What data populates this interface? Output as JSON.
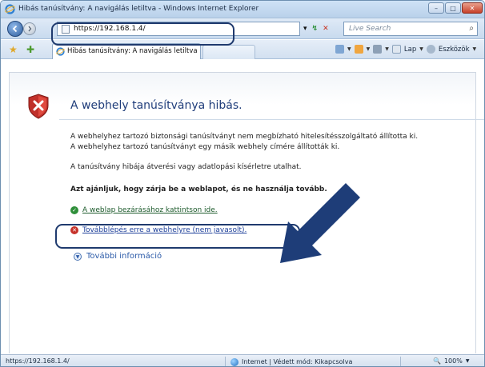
{
  "window": {
    "title": "Hibás tanúsítvány: A navigálás letiltva - Windows Internet Explorer",
    "controls": {
      "minimize": "–",
      "maximize": "□",
      "close": "✕"
    }
  },
  "address_bar": {
    "url": "https://192.168.1.4/",
    "dropdown_glyph": "▾",
    "refresh_glyph": "↯",
    "stop_glyph": "✕",
    "search_placeholder": "Live Search",
    "search_glyph": "⌕"
  },
  "tabs": [
    {
      "label": "Hibás tanúsítvány: A navigálás letiltva"
    }
  ],
  "command_bar": {
    "page_label": "Lap",
    "tools_label": "Eszközök"
  },
  "page": {
    "heading": "A webhely tanúsítványa hibás.",
    "para1_line1": "A webhelyhez tartozó biztonsági tanúsítványt nem megbízható hitelesítésszolgáltató állította ki.",
    "para1_line2": "A webhelyhez tartozó tanúsítványt egy másik webhely címére állították ki.",
    "para2": "A tanúsítvány hibája átverési vagy adatlopási kísérletre utalhat.",
    "recommendation": "Azt ajánljuk, hogy zárja be a weblapot, és ne használja tovább.",
    "close_link": "A weblap bezárásához kattintson ide.",
    "continue_link": "Továbblépés erre a webhelyre (nem javasolt).",
    "more_info": "További információ"
  },
  "status_bar": {
    "url": "https://192.168.1.4/",
    "zone": "Internet | Védett mód: Kikapcsolva",
    "zoom": "100%"
  },
  "colors": {
    "heading": "#1f3d7a",
    "link": "#1d3f9a",
    "annotation": "#1f3a6e"
  }
}
